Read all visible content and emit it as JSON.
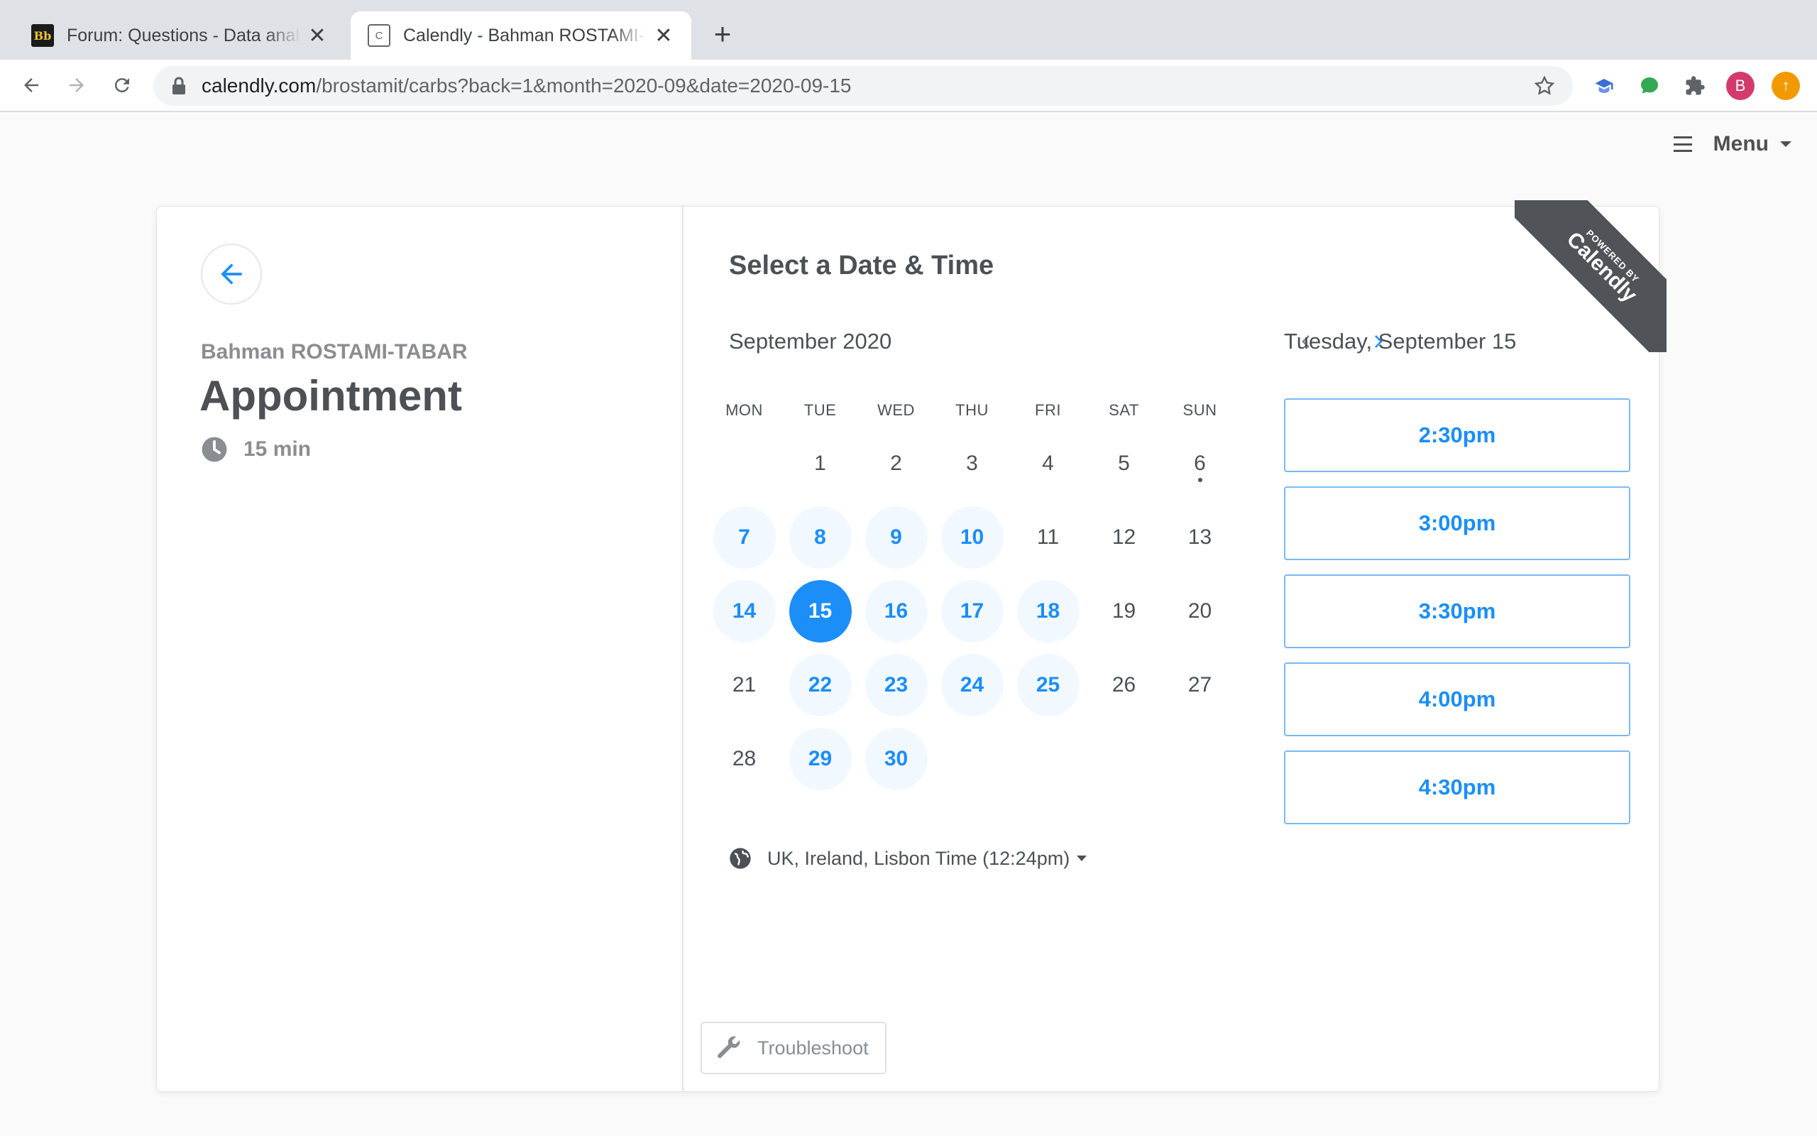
{
  "browser": {
    "tabs": [
      {
        "title": "Forum: Questions - Data analyti",
        "favicon": "blackboard-icon",
        "active": false
      },
      {
        "title": "Calendly - Bahman ROSTAMI-TABAR",
        "favicon": "calendly-icon",
        "active": true
      }
    ],
    "close_symbol": "✕",
    "newtab_symbol": "+",
    "favicon_bb": "Bb",
    "favicon_cal": "C",
    "url_domain": "calendly.com",
    "url_path": "/brostamit/carbs?back=1&month=2020-09&date=2020-09-15",
    "avatar_letter": "B",
    "orange_ext_symbol": "↑"
  },
  "page": {
    "menu_label": "Menu",
    "host_name": "Bahman ROSTAMI-TABAR",
    "event_title": "Appointment",
    "duration": "15 min",
    "select_title": "Select a Date & Time",
    "month_label": "September 2020",
    "weekdays": [
      "MON",
      "TUE",
      "WED",
      "THU",
      "FRI",
      "SAT",
      "SUN"
    ],
    "selected_date_label": "Tuesday, September 15",
    "time_slots": [
      "2:30pm",
      "3:00pm",
      "3:30pm",
      "4:00pm",
      "4:30pm"
    ],
    "timezone": "UK, Ireland, Lisbon Time (12:24pm)",
    "troubleshoot_label": "Troubleshoot",
    "ribbon_powered": "POWERED BY",
    "ribbon_brand": "Calendly"
  },
  "calendar": {
    "days": [
      {
        "d": "",
        "s": "empty"
      },
      {
        "d": "1",
        "s": "plain"
      },
      {
        "d": "2",
        "s": "plain"
      },
      {
        "d": "3",
        "s": "plain"
      },
      {
        "d": "4",
        "s": "plain"
      },
      {
        "d": "5",
        "s": "plain"
      },
      {
        "d": "6",
        "s": "today"
      },
      {
        "d": "7",
        "s": "avail"
      },
      {
        "d": "8",
        "s": "avail"
      },
      {
        "d": "9",
        "s": "avail"
      },
      {
        "d": "10",
        "s": "avail"
      },
      {
        "d": "11",
        "s": "plain"
      },
      {
        "d": "12",
        "s": "plain"
      },
      {
        "d": "13",
        "s": "plain"
      },
      {
        "d": "14",
        "s": "avail"
      },
      {
        "d": "15",
        "s": "sel"
      },
      {
        "d": "16",
        "s": "avail"
      },
      {
        "d": "17",
        "s": "avail"
      },
      {
        "d": "18",
        "s": "avail"
      },
      {
        "d": "19",
        "s": "plain"
      },
      {
        "d": "20",
        "s": "plain"
      },
      {
        "d": "21",
        "s": "plain"
      },
      {
        "d": "22",
        "s": "avail"
      },
      {
        "d": "23",
        "s": "avail"
      },
      {
        "d": "24",
        "s": "avail"
      },
      {
        "d": "25",
        "s": "avail"
      },
      {
        "d": "26",
        "s": "plain"
      },
      {
        "d": "27",
        "s": "plain"
      },
      {
        "d": "28",
        "s": "plain"
      },
      {
        "d": "29",
        "s": "avail"
      },
      {
        "d": "30",
        "s": "avail"
      }
    ]
  },
  "colors": {
    "accent": "#1b8ef8",
    "available_bg": "#f2f8ff",
    "text": "#4d5055",
    "muted": "#8a8d92"
  }
}
